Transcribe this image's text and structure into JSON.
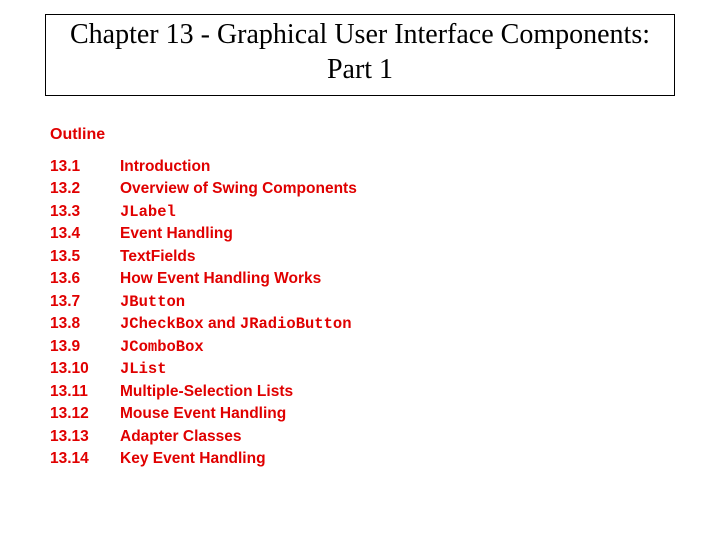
{
  "title": "Chapter 13 - Graphical User Interface Components: Part 1",
  "outline_heading": "Outline",
  "items": [
    {
      "num": "13.1",
      "parts": [
        {
          "t": "Introduction",
          "code": false
        }
      ]
    },
    {
      "num": "13.2",
      "parts": [
        {
          "t": "Overview of Swing Components",
          "code": false
        }
      ]
    },
    {
      "num": "13.3",
      "parts": [
        {
          "t": "JLabel",
          "code": true
        }
      ]
    },
    {
      "num": "13.4",
      "parts": [
        {
          "t": "Event Handling",
          "code": false
        }
      ]
    },
    {
      "num": "13.5",
      "parts": [
        {
          "t": "TextFields",
          "code": false
        }
      ]
    },
    {
      "num": "13.6",
      "parts": [
        {
          "t": "How Event Handling Works",
          "code": false
        }
      ]
    },
    {
      "num": "13.7",
      "parts": [
        {
          "t": "JButton",
          "code": true
        }
      ]
    },
    {
      "num": "13.8",
      "parts": [
        {
          "t": "JCheckBox",
          "code": true
        },
        {
          "t": " and ",
          "code": false
        },
        {
          "t": "JRadioButton",
          "code": true
        }
      ]
    },
    {
      "num": "13.9",
      "parts": [
        {
          "t": "JComboBox",
          "code": true
        }
      ]
    },
    {
      "num": "13.10",
      "parts": [
        {
          "t": "JList",
          "code": true
        }
      ]
    },
    {
      "num": "13.11",
      "parts": [
        {
          "t": "Multiple-Selection Lists",
          "code": false
        }
      ]
    },
    {
      "num": "13.12",
      "parts": [
        {
          "t": "Mouse Event Handling",
          "code": false
        }
      ]
    },
    {
      "num": "13.13",
      "parts": [
        {
          "t": "Adapter Classes",
          "code": false
        }
      ]
    },
    {
      "num": "13.14",
      "parts": [
        {
          "t": "Key Event Handling",
          "code": false
        }
      ]
    }
  ]
}
